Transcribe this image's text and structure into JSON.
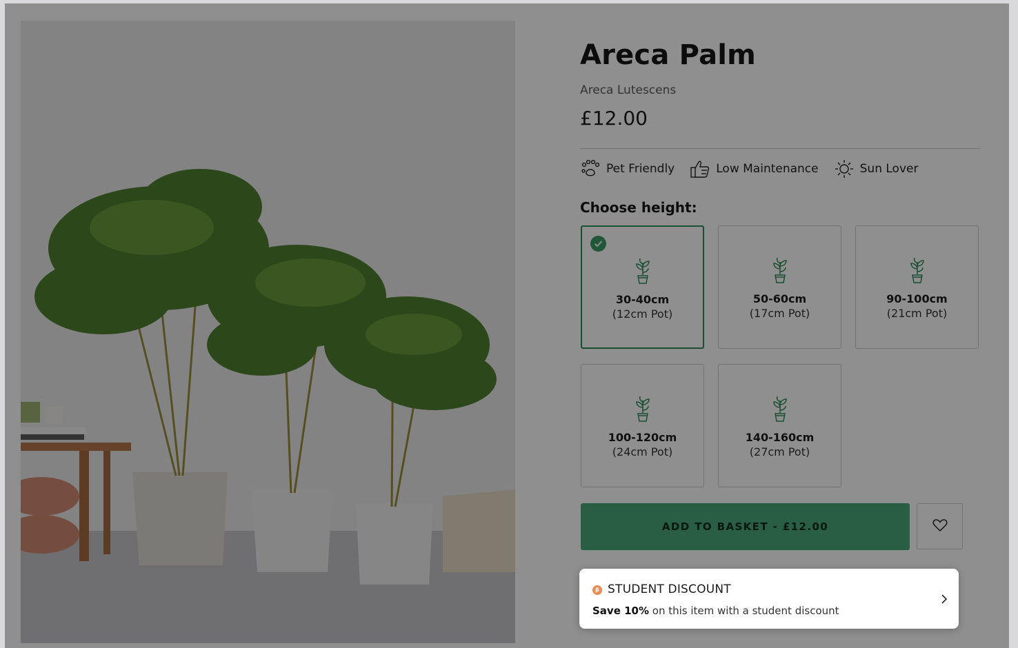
{
  "product": {
    "title": "Areca Palm",
    "latin_name": "Areca Lutescens",
    "price": "£12.00"
  },
  "features": [
    {
      "label": "Pet Friendly",
      "icon": "paw-icon"
    },
    {
      "label": "Low Maintenance",
      "icon": "thumbs-up-icon"
    },
    {
      "label": "Sun Lover",
      "icon": "sun-icon"
    }
  ],
  "height": {
    "label": "Choose height:",
    "selected_index": 0,
    "options": [
      {
        "height": "30-40cm",
        "pot": "(12cm Pot)"
      },
      {
        "height": "50-60cm",
        "pot": "(17cm Pot)"
      },
      {
        "height": "90-100cm",
        "pot": "(21cm Pot)"
      },
      {
        "height": "100-120cm",
        "pot": "(24cm Pot)"
      },
      {
        "height": "140-160cm",
        "pot": "(27cm Pot)"
      }
    ]
  },
  "actions": {
    "add_to_basket": "ADD TO BASKET - £12.00",
    "wishlist_icon": "heart-icon"
  },
  "student_discount": {
    "title": "STUDENT DISCOUNT",
    "desc_bold": "Save 10%",
    "desc_rest": " on this item with a student discount",
    "icon": "student-beans-icon",
    "chevron": "chevron-right-icon"
  },
  "colors": {
    "accent_green": "#4aa87a",
    "selected_border": "#2f8c5a",
    "discount_icon": "#f08a55"
  }
}
